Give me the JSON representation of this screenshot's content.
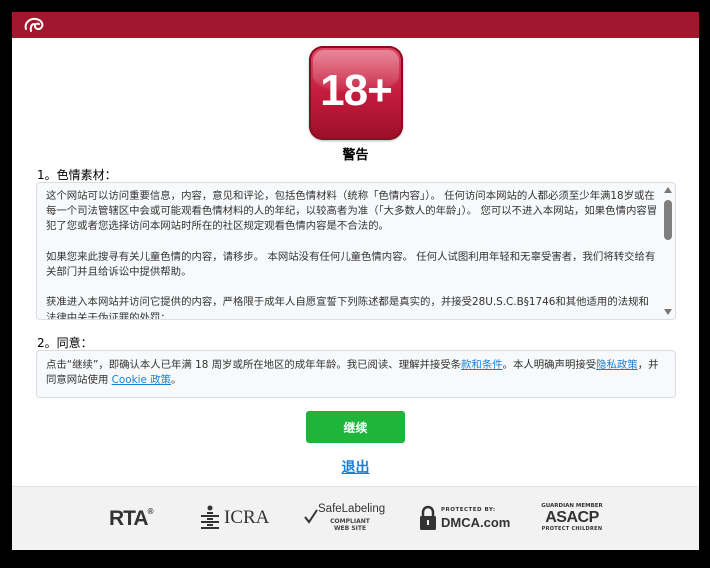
{
  "badge": {
    "text": "18+",
    "color": "#c41c3d"
  },
  "warning_title": "警告",
  "section1": {
    "label": "1。色情素材：",
    "paragraphs": [
      "这个网站可以访问重要信息，内容，意见和评论，包括色情材料（统称「色情内容」）。 任何访问本网站的人都必须至少年满18岁或在每一个司法管辖区中会或可能观看色情材料的人的年纪，以较高者为准（「大多数人的年龄」）。 您可以不进入本网站，如果色情内容冒犯了您或者您选择访问本网站时所在的社区规定观看色情内容是不合法的。",
      "如果您来此搜寻有关儿童色情的内容，请移步。 本网站没有任何儿童色情内容。 任何人试图利用年轻和无辜受害者，我们将转交给有关部门并且给诉讼中提供帮助。",
      "获准进入本网站并访问它提供的内容，严格限于成年人自愿宣誓下列陈述都是真实的，并接受28U.S.C.B§1746和其他适用的法规和法律中关于伪证罪的处罚："
    ]
  },
  "section2": {
    "label": "2。同意：",
    "text_before_terms": "点击“继续”，即确认本人已年满 18 周岁或所在地区的成年年龄。我已阅读、理解并接受条",
    "terms_link": "款和条件",
    "text_before_privacy": "。本人明确声明接受",
    "privacy_link": "隐私政策",
    "text_before_cookie": "，并同意网站使用 ",
    "cookie_link": "Cookie 政策",
    "text_end": "。"
  },
  "buttons": {
    "continue": "继续",
    "exit": "退出"
  },
  "footer_logos": {
    "rta": "RTA",
    "rta_mark": "®",
    "icra": "ICRA",
    "safelabeling": "SafeLabeling",
    "safelabeling_sub1": "COMPLIANT",
    "safelabeling_sub2": "WEB SITE",
    "dmca_protected": "PROTECTED BY:",
    "dmca": "DMCA.com",
    "asacp_top": "GUARDIAN MEMBER",
    "asacp": "ASACP",
    "asacp_sub": "PROTECT CHILDREN"
  },
  "colors": {
    "topbar": "#a0182e",
    "continue_button": "#1fb53a",
    "link": "#1a7fd4"
  },
  "icons": {
    "site_logo": "site-logo-icon",
    "lock": "lock-icon",
    "scroll_up": "scroll-up-arrow-icon",
    "scroll_down": "scroll-down-arrow-icon"
  }
}
